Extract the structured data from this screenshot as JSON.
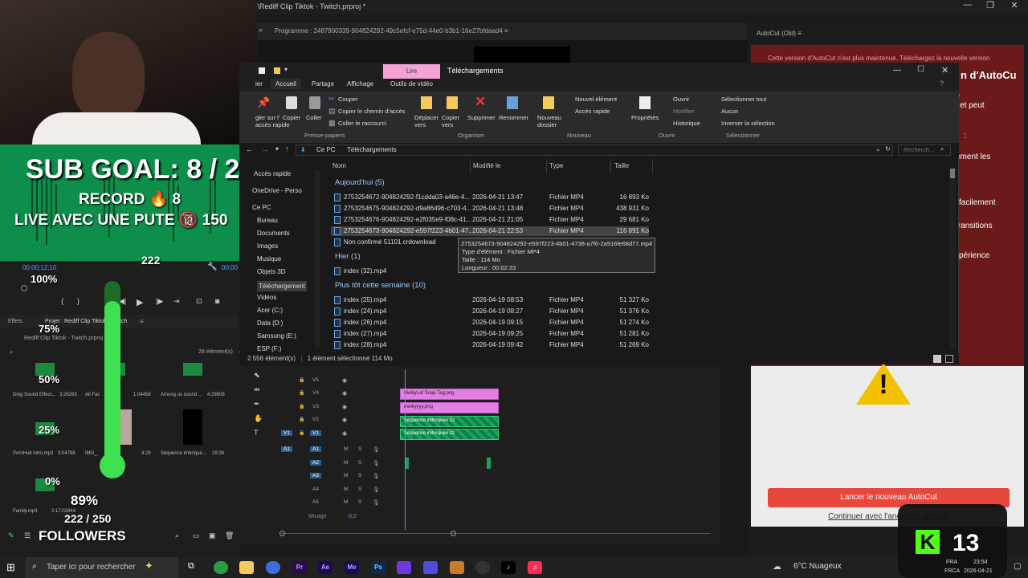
{
  "premiere": {
    "window_title": ":\\Rediff Clip Tiktok - Twitch.prproj *",
    "program_label": "Programme : 2487900339-904824292-49c5efcf-e75d-44e0-b3b1-16e27bfdaad4",
    "autocut_tab": "AutoCut (Old)",
    "autocut_heading": "n d'AutoCu",
    "autocut_warning": "Cette version d'AutoCut n'est plus maintenue. Téléchargez la nouvelle version",
    "autocut_lines": [
      "ue",
      "ut et peut",
      ":",
      "ement les",
      "facilement",
      "transitions",
      "périence"
    ],
    "autocut_launch": "Lancer le nouveau AutoCut",
    "autocut_continue": "Continuer avec l'ancienne version",
    "timecode": "00;00;12;10",
    "timecode2": "00;00",
    "effects_tab": "Effets",
    "project_tab": "Projet : Rediff Clip Tiktok - Twitch",
    "project_file": "Rediff Clip Tiktok - Twitch.prproj",
    "project_count": "28 élément(s)",
    "mixage": "Mixage",
    "mixage_val": "0,0"
  },
  "project_items": [
    {
      "name": "Ding Sound Effect...",
      "dur": "3:26283"
    },
    {
      "name": "All Fac",
      "dur": "1:04458"
    },
    {
      "name": "Among us sound ...",
      "dur": "4:29808"
    },
    {
      "name": "PornHub intro.mp3",
      "dur": "3:04788"
    },
    {
      "name": "IMG_",
      "dur": "4:29"
    },
    {
      "name": "Séquence imbriqué...",
      "dur": "29:26"
    },
    {
      "name": "Family.mp3",
      "dur": "2:17:02844"
    }
  ],
  "tracks_video": [
    "V5",
    "V4",
    "V3",
    "V2",
    "V1"
  ],
  "tracks_audio": [
    "A1",
    "A2",
    "A3",
    "A4",
    "A5"
  ],
  "clips": [
    "MelkyLaf Snap Tag.png",
    "melkyyyy.png",
    "Séquence imbriquée 22",
    "Séquence imbriquée 22"
  ],
  "overlay": {
    "sub_goal": "SUB GOAL: 8 / 25",
    "record": "RECORD 🔥 8",
    "live": "LIVE AVEC UNE PUTE 🔞 150",
    "count_222": "222",
    "pct_100": "100%",
    "pct_75": "75%",
    "pct_50": "50%",
    "pct_25": "25%",
    "pct_0": "0%",
    "followers_pct": "89%",
    "followers_count": "222 / 250",
    "followers_label": "FOLLOWERS",
    "followers_progress": 0.89
  },
  "explorer": {
    "lire_tab": "Lire",
    "title": "Téléchargements",
    "tabs": [
      "ier",
      "Accueil",
      "Partage",
      "Affichage",
      "Outils de vidéo"
    ],
    "ribbon": {
      "coller_raccourci_partial": "gler sur l'\naccès rapide",
      "copier": "Copier",
      "coller": "Coller",
      "couper": "Couper",
      "copier_chemin": "Copier le chemin d'accès",
      "coller_raccourci": "Coller le raccourci",
      "deplacer": "Déplacer\nvers",
      "copier_vers": "Copier\nvers",
      "supprimer": "Supprimer",
      "renommer": "Renommer",
      "nouveau_dossier": "Nouveau\ndossier",
      "nouvel_element": "Nouvel élément",
      "acces_rapide": "Accès rapide",
      "proprietes": "Propriétés",
      "ouvrir": "Ouvrir",
      "modifier": "Modifier",
      "historique": "Historique",
      "selectionner_tout": "Sélectionner tout",
      "aucun": "Aucun",
      "inverser": "Inverser la sélection",
      "groups": [
        "Presse-papiers",
        "Organiser",
        "Nouveau",
        "Ouvrir",
        "Sélectionner"
      ]
    },
    "breadcrumb": [
      "Ce PC",
      "Téléchargements"
    ],
    "search_placeholder": "Recherch...",
    "nav": [
      "Accès rapide",
      "OneDrive - Perso",
      "Ce PC",
      "Bureau",
      "Documents",
      "Images",
      "Musique",
      "Objets 3D",
      "Téléchargement",
      "Vidéos",
      "Acer (C:)",
      "Data (D:)",
      "Samsung (E:)",
      "ESP (F:)"
    ],
    "columns": [
      "Nom",
      "Modifié le",
      "Type",
      "Taille"
    ],
    "groups": [
      {
        "label": "Aujourd'hui (5)",
        "rows": [
          {
            "name": "2753254672-904824292-f1cdda03-a46e-4...",
            "date": "2026-04-21 13:47",
            "type": "Fichier MP4",
            "size": "16 893 Ko"
          },
          {
            "name": "2753254675-904824292-d9a86496-c703-4...",
            "date": "2026-04-21 13:48",
            "type": "Fichier MP4",
            "size": "438 931 Ko"
          },
          {
            "name": "2753254676-904824292-e2f035e9-f08c-41...",
            "date": "2026-04-21 21:05",
            "type": "Fichier MP4",
            "size": "29 681 Ko"
          },
          {
            "name": "2753254673-904824292-e597f223-4b01-47...",
            "date": "2026-04-21 22:53",
            "type": "Fichier MP4",
            "size": "116 891 Ko"
          },
          {
            "name": "Non confirmé 51101.crdownload",
            "date": "",
            "type": "",
            "size": ""
          }
        ]
      },
      {
        "label": "Hier (1)",
        "rows": [
          {
            "name": "index (32).mp4",
            "date": "",
            "type": "",
            "size": ""
          }
        ]
      },
      {
        "label": "Plus tôt cette semaine (10)",
        "rows": [
          {
            "name": "index (25).mp4",
            "date": "2026-04-19 08:53",
            "type": "Fichier MP4",
            "size": "51 327 Ko"
          },
          {
            "name": "index (24).mp4",
            "date": "2026-04-19 08:27",
            "type": "Fichier MP4",
            "size": "51 376 Ko"
          },
          {
            "name": "index (26).mp4",
            "date": "2026-04-19 09:15",
            "type": "Fichier MP4",
            "size": "51 274 Ko"
          },
          {
            "name": "index (27).mp4",
            "date": "2026-04-19 09:25",
            "type": "Fichier MP4",
            "size": "51 281 Ko"
          },
          {
            "name": "index (28).mp4",
            "date": "2026-04-19 09:42",
            "type": "Fichier MP4",
            "size": "51 269 Ko"
          }
        ]
      }
    ],
    "tooltip": {
      "name": "2753254673-904824292-e597f223-4b01-4738-a7f6-2a916fe68d77.mp4",
      "type": "Type d'élément : Fichier MP4",
      "size": "Taille : 114 Mo",
      "length": "Longueur : 00:02:33"
    },
    "status_count": "2 556 élément(s)",
    "status_sel": "1 élément sélectionné  114 Mo"
  },
  "taskbar": {
    "search": "Taper ici pour rechercher",
    "weather": "6°C  Nuageux",
    "kick_count": "13",
    "lang": "FRA",
    "lang2": "FRCA",
    "time": "23:54",
    "date": "2026-04-21"
  }
}
